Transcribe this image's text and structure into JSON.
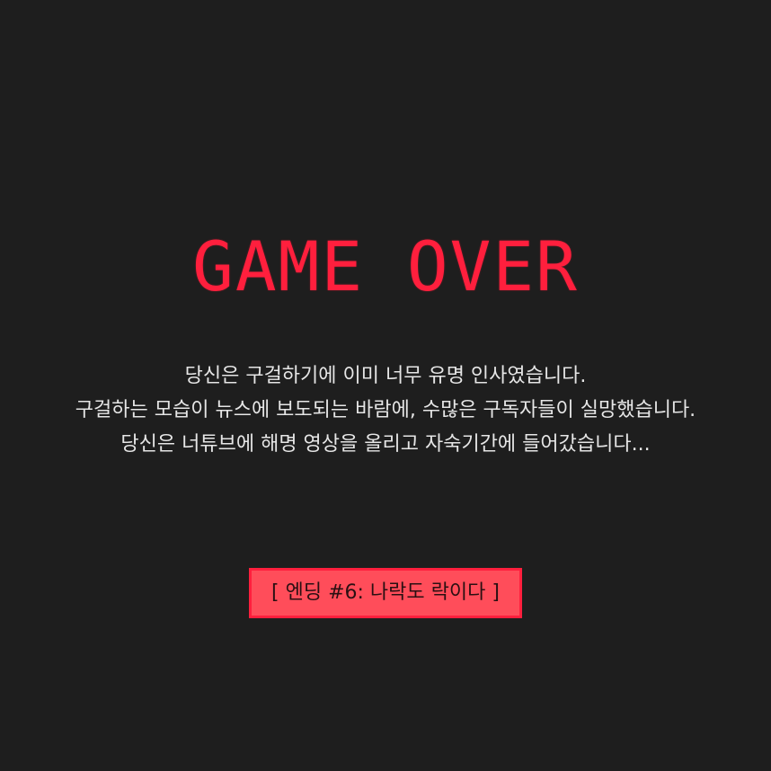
{
  "game_over": {
    "title": "GAME OVER",
    "message_lines": [
      "당신은 구걸하기에 이미 너무 유명 인사였습니다.",
      "구걸하는 모습이 뉴스에 보도되는 바람에, 수많은 구독자들이 실망했습니다.",
      "당신은 너튜브에 해명 영상을 올리고 자숙기간에 들어갔습니다..."
    ],
    "ending_label": "[ 엔딩 #6: 나락도 락이다 ]"
  },
  "colors": {
    "background": "#1e1e1e",
    "title": "#ff1f3d",
    "text": "#e6e6e6",
    "badge_fill": "#ff4d5a",
    "badge_border": "#ff1f3d"
  }
}
